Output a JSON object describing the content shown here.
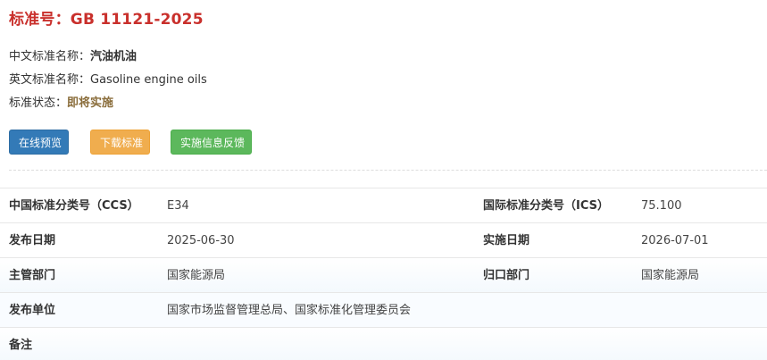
{
  "header": {
    "title": "标准号：GB 11121-2025"
  },
  "info": {
    "cn_name_label": "中文标准名称：",
    "cn_name_value": "汽油机油",
    "en_name_label": "英文标准名称：",
    "en_name_value": "Gasoline engine oils",
    "status_label": "标准状态：",
    "status_value": "即将实施"
  },
  "buttons": {
    "preview": "在线预览",
    "download": "下载标准",
    "feedback": "实施信息反馈"
  },
  "colors": {
    "title": "#c9302c",
    "status": "#8a6d3b",
    "preview": "#337ab7",
    "download": "#f0ad4e",
    "feedback": "#5cb85c"
  },
  "table": {
    "rows": [
      {
        "label1": "中国标准分类号（CCS）",
        "value1": "E34",
        "label2": "国际标准分类号（ICS）",
        "value2": "75.100"
      },
      {
        "label1": "发布日期",
        "value1": "2025-06-30",
        "label2": "实施日期",
        "value2": "2026-07-01"
      },
      {
        "label1": "主管部门",
        "value1": "国家能源局",
        "label2": "归口部门",
        "value2": "国家能源局"
      },
      {
        "label1": "发布单位",
        "value1": "国家市场监督管理总局、国家标准化管理委员会",
        "label2": "",
        "value2": ""
      },
      {
        "label1": "备注",
        "value1": "",
        "label2": "",
        "value2": ""
      }
    ]
  }
}
